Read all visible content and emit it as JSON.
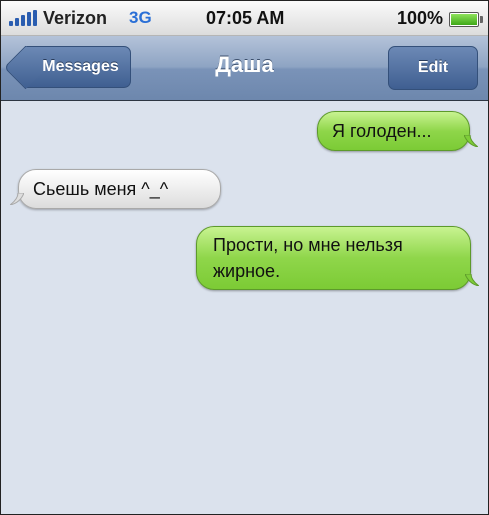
{
  "status_bar": {
    "carrier": "Verizon",
    "network": "3G",
    "time": "07:05 AM",
    "battery_percent": "100%",
    "signal_icon": "signal-bars-icon",
    "battery_icon": "battery-icon"
  },
  "nav": {
    "back_label": "Messages",
    "title": "Даша",
    "edit_label": "Edit"
  },
  "messages": [
    {
      "direction": "outgoing",
      "text": "Я голоден..."
    },
    {
      "direction": "incoming",
      "text": "Сьешь меня ^_^"
    },
    {
      "direction": "outgoing",
      "text": "Прости, но мне нельзя жирное."
    }
  ],
  "colors": {
    "outgoing_bubble": "#8fd64a",
    "incoming_bubble": "#ececec",
    "background": "#dbe2ed",
    "nav_bar": "#7a93b8"
  }
}
